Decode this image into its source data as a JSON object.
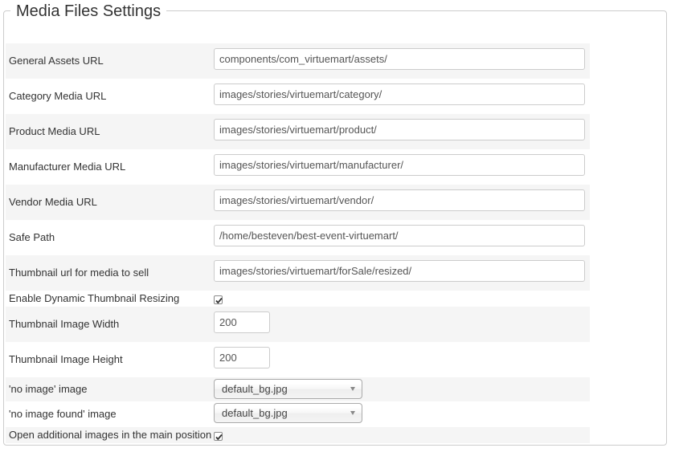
{
  "fieldset": {
    "legend": "Media Files Settings"
  },
  "fields": {
    "general_assets_url": {
      "label": "General Assets URL",
      "value": "components/com_virtuemart/assets/"
    },
    "category_media_url": {
      "label": "Category Media URL",
      "value": "images/stories/virtuemart/category/"
    },
    "product_media_url": {
      "label": "Product Media URL",
      "value": "images/stories/virtuemart/product/"
    },
    "manufacturer_media_url": {
      "label": "Manufacturer Media URL",
      "value": "images/stories/virtuemart/manufacturer/"
    },
    "vendor_media_url": {
      "label": "Vendor Media URL",
      "value": "images/stories/virtuemart/vendor/"
    },
    "safe_path": {
      "label": "Safe Path",
      "value": "/home/besteven/best-event-virtuemart/"
    },
    "thumbnail_url_for_sale": {
      "label": "Thumbnail url for media to sell",
      "value": "images/stories/virtuemart/forSale/resized/"
    },
    "dynamic_thumbnail_resizing": {
      "label": "Enable Dynamic Thumbnail Resizing",
      "checked": true
    },
    "thumbnail_width": {
      "label": "Thumbnail Image Width",
      "value": "200"
    },
    "thumbnail_height": {
      "label": "Thumbnail Image Height",
      "value": "200"
    },
    "no_image": {
      "label": "'no image' image",
      "selected": "default_bg.jpg"
    },
    "no_image_found": {
      "label": "'no image found' image",
      "selected": "default_bg.jpg"
    },
    "open_additional_images": {
      "label": "Open additional images in the main position",
      "checked": true
    }
  },
  "icons": {
    "dropdown": "chevron-down-icon",
    "check": "checkmark-icon"
  },
  "colors": {
    "row_alt_bg": "#f5f5f5",
    "border": "#cccccc",
    "text": "#333333"
  }
}
